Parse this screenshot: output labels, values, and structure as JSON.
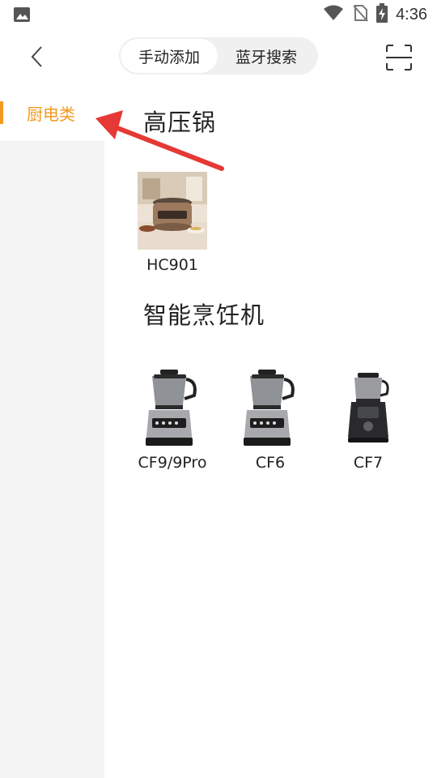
{
  "status_bar": {
    "time": "4:36",
    "icons": [
      "image-icon",
      "wifi-icon",
      "no-sim-icon",
      "battery-charging-icon"
    ]
  },
  "toolbar": {
    "back_icon": "chevron-left-icon",
    "tabs": [
      {
        "label": "手动添加",
        "active": true
      },
      {
        "label": "蓝牙搜索",
        "active": false
      }
    ],
    "scan_icon": "scan-icon"
  },
  "sidebar": {
    "items": [
      {
        "label": "厨电类",
        "selected": true
      }
    ]
  },
  "content": {
    "categories": [
      {
        "title": "高压锅",
        "products": [
          {
            "label": "HC901",
            "image": "pressure-cooker-image"
          }
        ]
      },
      {
        "title": "智能烹饪机",
        "products": [
          {
            "label": "CF9/9Pro",
            "image": "cooking-machine-image"
          },
          {
            "label": "CF6",
            "image": "cooking-machine-image"
          },
          {
            "label": "CF7",
            "image": "cooking-machine-compact-image"
          }
        ]
      }
    ]
  },
  "colors": {
    "accent": "#f39a1f",
    "sidebar_bg": "#f4f4f4",
    "segment_bg": "#f0f0f0",
    "annotation_arrow": "#e53935"
  }
}
